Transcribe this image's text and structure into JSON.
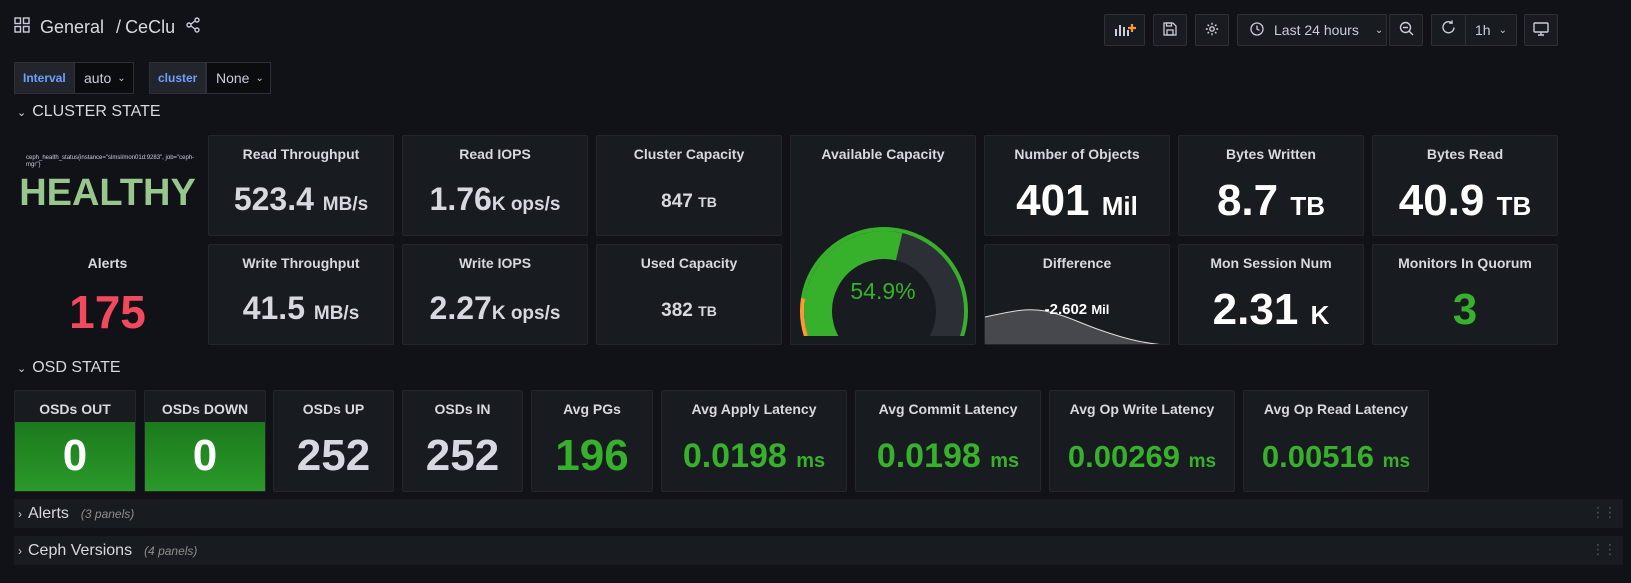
{
  "breadcrumb": {
    "folder": "General",
    "separator": "/",
    "dashboard": "CeClu"
  },
  "toolbar": {
    "time_range": "Last 24 hours",
    "refresh_interval": "1h"
  },
  "variables": [
    {
      "label": "Interval",
      "value": "auto"
    },
    {
      "label": "cluster",
      "value": "None"
    }
  ],
  "cluster_state": {
    "title": "CLUSTER STATE",
    "health": {
      "query": "ceph_health_status{instance=\"slmsl/mon01d:9283\", job=\"ceph-mgr\"}",
      "value": "HEALTHY"
    },
    "alerts": {
      "title": "Alerts",
      "value": "175"
    },
    "read_throughput": {
      "title": "Read Throughput",
      "value": "523.4",
      "unit": "MB/s"
    },
    "read_iops": {
      "title": "Read IOPS",
      "value": "1.76",
      "unit": "K ops/s"
    },
    "cluster_capacity": {
      "title": "Cluster Capacity",
      "value": "847",
      "unit": "TB"
    },
    "available_capacity": {
      "title": "Available Capacity",
      "value": "54.9%",
      "percent": 54.9
    },
    "number_of_objects": {
      "title": "Number of Objects",
      "value": "401",
      "unit": "Mil"
    },
    "bytes_written": {
      "title": "Bytes Written",
      "value": "8.7",
      "unit": "TB"
    },
    "bytes_read": {
      "title": "Bytes Read",
      "value": "40.9",
      "unit": "TB"
    },
    "write_throughput": {
      "title": "Write Throughput",
      "value": "41.5",
      "unit": "MB/s"
    },
    "write_iops": {
      "title": "Write IOPS",
      "value": "2.27",
      "unit": "K ops/s"
    },
    "used_capacity": {
      "title": "Used Capacity",
      "value": "382",
      "unit": "TB"
    },
    "difference": {
      "title": "Difference",
      "value": "-2.602",
      "unit": "Mil"
    },
    "mon_session_num": {
      "title": "Mon Session Num",
      "value": "2.31",
      "unit": "K"
    },
    "monitors_in_quorum": {
      "title": "Monitors In Quorum",
      "value": "3"
    }
  },
  "osd_state": {
    "title": "OSD STATE",
    "osds_out": {
      "title": "OSDs OUT",
      "value": "0"
    },
    "osds_down": {
      "title": "OSDs DOWN",
      "value": "0"
    },
    "osds_up": {
      "title": "OSDs UP",
      "value": "252"
    },
    "osds_in": {
      "title": "OSDs IN",
      "value": "252"
    },
    "avg_pgs": {
      "title": "Avg PGs",
      "value": "196"
    },
    "avg_apply_latency": {
      "title": "Avg Apply Latency",
      "value": "0.0198",
      "unit": "ms"
    },
    "avg_commit_latency": {
      "title": "Avg Commit Latency",
      "value": "0.0198",
      "unit": "ms"
    },
    "avg_op_write_latency": {
      "title": "Avg Op Write Latency",
      "value": "0.00269",
      "unit": "ms"
    },
    "avg_op_read_latency": {
      "title": "Avg Op Read Latency",
      "value": "0.00516",
      "unit": "ms"
    }
  },
  "collapsed_rows": [
    {
      "title": "Alerts",
      "count": "(3 panels)"
    },
    {
      "title": "Ceph Versions",
      "count": "(4 panels)"
    }
  ],
  "colors": {
    "green": "#37b02c",
    "red": "#f2495c",
    "health": "#98c68d",
    "text": "#d8d9e0",
    "bg": "#111217",
    "panel": "#181b1f"
  },
  "icons": [
    "apps-icon",
    "share-icon",
    "add-panel-icon",
    "save-icon",
    "gear-icon",
    "clock-icon",
    "zoom-out-icon",
    "refresh-icon",
    "tv-icon"
  ]
}
